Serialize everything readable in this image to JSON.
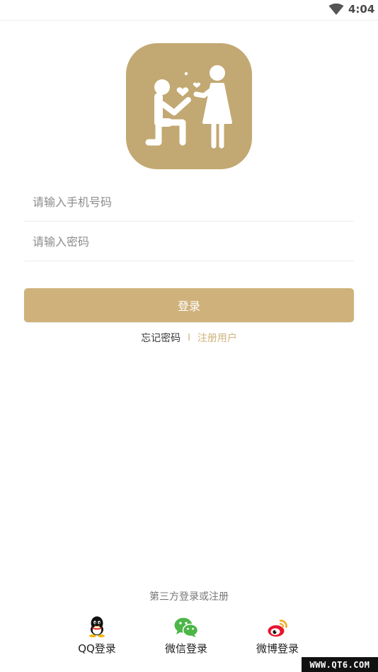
{
  "status_bar": {
    "time": "4:04",
    "wifi_icon": "wifi-icon"
  },
  "logo": {
    "icon": "proposal-couple-icon",
    "background_color": "#c2a872"
  },
  "form": {
    "phone_placeholder": "请输入手机号码",
    "phone_value": "",
    "password_placeholder": "请输入密码",
    "password_value": ""
  },
  "login_button": {
    "label": "登录",
    "color": "#cfb27b"
  },
  "links": {
    "forgot": "忘记密码",
    "separator": "I",
    "register": "注册用户"
  },
  "third_party": {
    "title": "第三方登录或注册",
    "items": [
      {
        "label": "QQ登录",
        "icon": "qq-icon"
      },
      {
        "label": "微信登录",
        "icon": "wechat-icon"
      },
      {
        "label": "微博登录",
        "icon": "weibo-icon"
      }
    ]
  },
  "watermark": "WWW.QT6.COM"
}
